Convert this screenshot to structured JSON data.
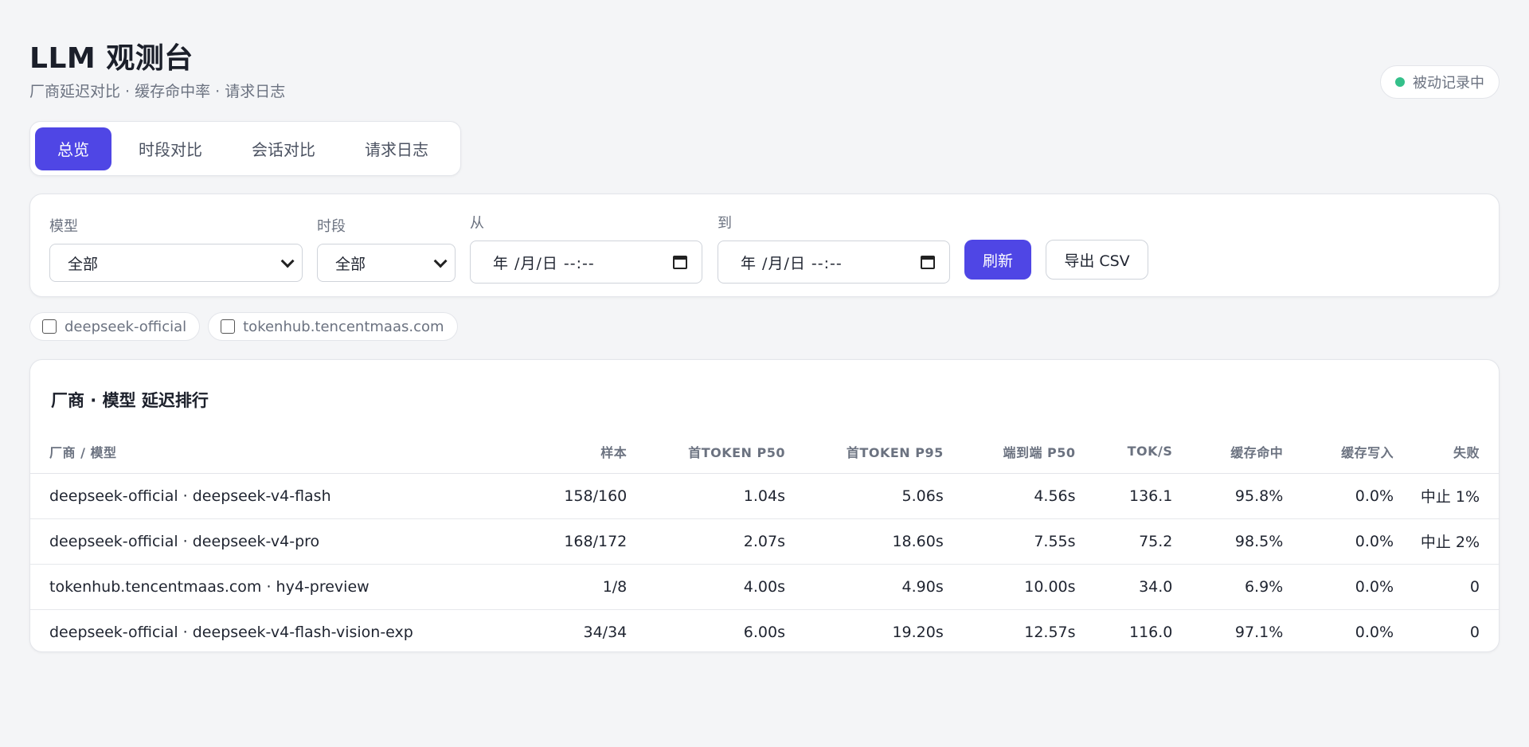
{
  "header": {
    "title": "LLM 观测台",
    "subtitle": "厂商延迟对比 · 缓存命中率 · 请求日志",
    "status": "被动记录中",
    "status_color": "#34c08a"
  },
  "tabs": [
    {
      "label": "总览",
      "active": true
    },
    {
      "label": "时段对比",
      "active": false
    },
    {
      "label": "会话对比",
      "active": false
    },
    {
      "label": "请求日志",
      "active": false
    }
  ],
  "filters": {
    "model": {
      "label": "模型",
      "value": "全部"
    },
    "period": {
      "label": "时段",
      "value": "全部"
    },
    "from": {
      "label": "从",
      "value": "年 /月/日 --:--"
    },
    "to": {
      "label": "到",
      "value": "年 /月/日 --:--"
    },
    "refresh_label": "刷新",
    "export_label": "导出 CSV"
  },
  "providers": [
    {
      "label": "deepseek-official",
      "checked": false
    },
    {
      "label": "tokenhub.tencentmaas.com",
      "checked": false
    }
  ],
  "table": {
    "title": "厂商 · 模型 延迟排行",
    "columns": [
      "厂商 / 模型",
      "样本",
      "首TOKEN P50",
      "首TOKEN P95",
      "端到端 P50",
      "TOK/S",
      "缓存命中",
      "缓存写入",
      "失败"
    ],
    "rows": [
      [
        "deepseek-official · deepseek-v4-flash",
        "158/160",
        "1.04s",
        "5.06s",
        "4.56s",
        "136.1",
        "95.8%",
        "0.0%",
        "中止 1%"
      ],
      [
        "deepseek-official · deepseek-v4-pro",
        "168/172",
        "2.07s",
        "18.60s",
        "7.55s",
        "75.2",
        "98.5%",
        "0.0%",
        "中止 2%"
      ],
      [
        "tokenhub.tencentmaas.com · hy4-preview",
        "1/8",
        "4.00s",
        "4.90s",
        "10.00s",
        "34.0",
        "6.9%",
        "0.0%",
        "0"
      ],
      [
        "deepseek-official · deepseek-v4-flash-vision-exp",
        "34/34",
        "6.00s",
        "19.20s",
        "12.57s",
        "116.0",
        "97.1%",
        "0.0%",
        "0"
      ]
    ]
  },
  "colors": {
    "accent": "#4f46e5",
    "background": "#f4f5f7"
  }
}
